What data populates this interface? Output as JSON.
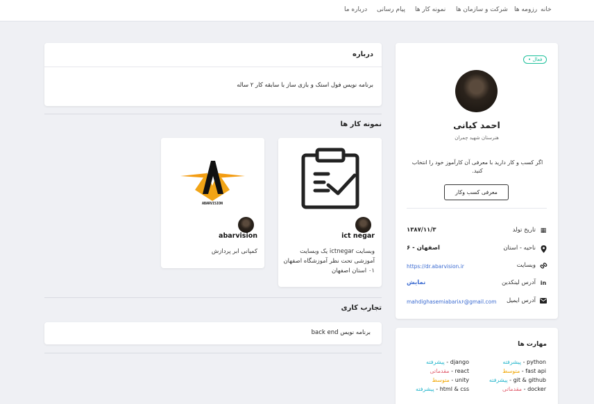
{
  "nav": {
    "items": [
      "خانه",
      "رزومه ها",
      "شرکت و سازمان ها",
      "نمونه کار ها",
      "پیام رسانی",
      "درباره ما"
    ]
  },
  "profile": {
    "status": "• فعال",
    "name": "احمد کیانی",
    "school": "هنرستان شهید چمران",
    "intro": "اگر کسب و کار دارید با معرفی آن کارآموز خود را انتخاب کنید.",
    "intro_button": "معرفی کسب وکار",
    "birth_label": "تاریخ تولد",
    "birth_value": "۱۳۸۷/۱۱/۳",
    "region_label": "ناحیه - استان",
    "region_value": "۶ - اصفهان",
    "website_label": "وبسایت",
    "website_value": "https://dr.abarvision.ir",
    "linkedin_label": "آدرس لینکدین",
    "linkedin_value": "نمایش",
    "email_label": "آدرس ایمیل",
    "email_value": "mahdighasemiabari۸۶@gmail.com"
  },
  "skills": {
    "title": "مهارت ها",
    "items": [
      {
        "name": "python",
        "level": "پیشرفته",
        "kind": "adv"
      },
      {
        "name": "django",
        "level": "پیشرفته",
        "kind": "adv"
      },
      {
        "name": "fast api",
        "level": "متوسط",
        "kind": "mid"
      },
      {
        "name": "react",
        "level": "مقدماتی",
        "kind": "beg"
      },
      {
        "name": "git & github",
        "level": "پیشرفته",
        "kind": "adv"
      },
      {
        "name": "unity",
        "level": "متوسط",
        "kind": "mid"
      },
      {
        "name": "docker",
        "level": "مقدماتی",
        "kind": "beg"
      },
      {
        "name": "html & css",
        "level": "پیشرفته",
        "kind": "adv"
      }
    ]
  },
  "about": {
    "title": "درباره",
    "text": "برنامه نویس فول استک و بازی ساز با سابقه کار ۲ ساله"
  },
  "works": {
    "title": "نمونه کار ها",
    "items": [
      {
        "title": "ict negar",
        "desc": "وبسایت ictnegar یک وبسایت آموزشی تحت نظر آموزشگاه اصفهان ۰۱ استان اصفهان",
        "icon": "clipboard-check-icon"
      },
      {
        "title": "abarvision",
        "desc": "کمپانی ابر پردازش",
        "icon": "abarvision-logo"
      }
    ]
  },
  "experience": {
    "title": "تجارب کاری",
    "items": [
      "برنامه نویس back end"
    ]
  },
  "colors": {
    "accent": "#3b6bd1",
    "active": "#1bbf9a",
    "advanced": "#25b6cc",
    "intermediate": "#f0a500",
    "beginner": "#e05a6a"
  }
}
